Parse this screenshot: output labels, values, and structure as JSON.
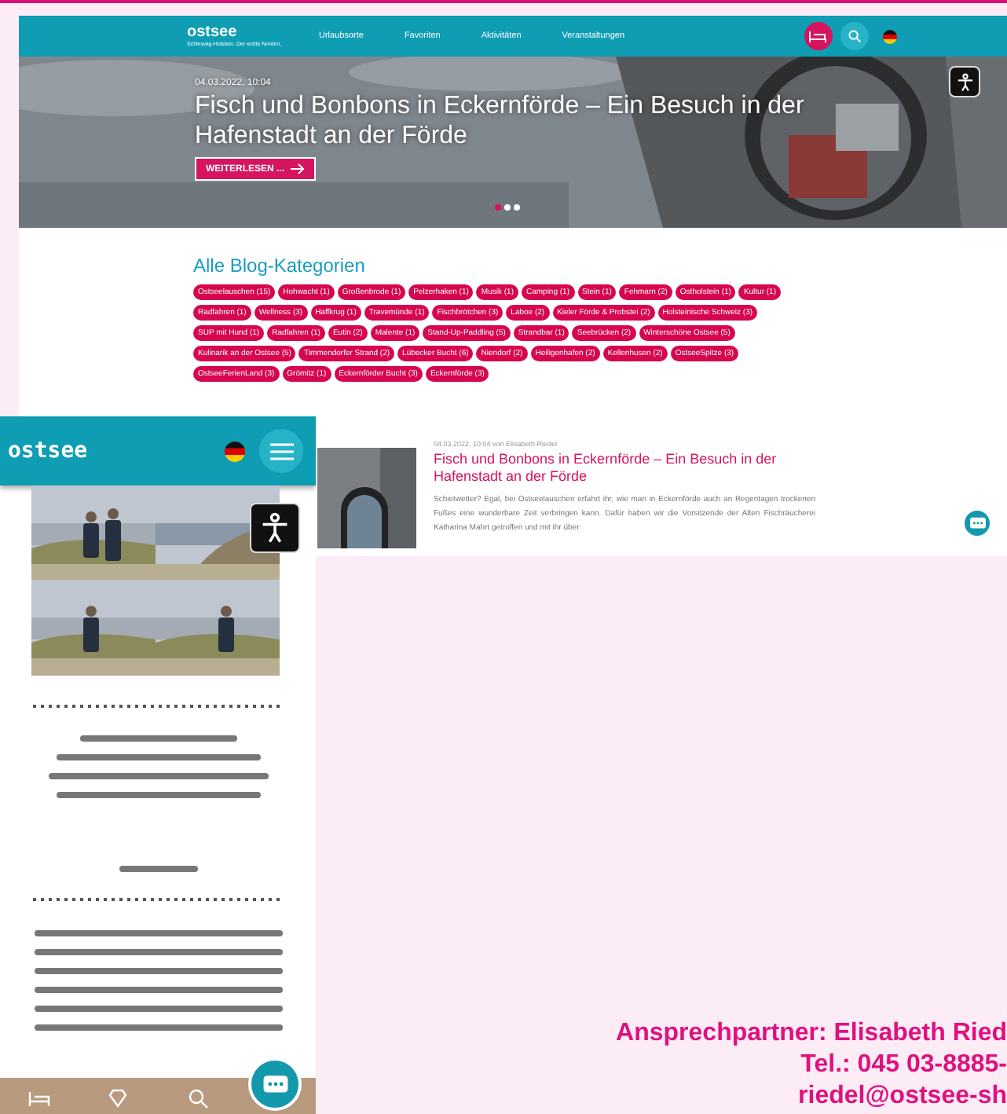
{
  "desktop": {
    "logo": {
      "name": "ostsee",
      "tagline": "Schleswig-Holstein. Der echte Norden."
    },
    "nav": [
      {
        "label": "Urlaubsorte"
      },
      {
        "label": "Favoriten"
      },
      {
        "label": "Aktivitäten"
      },
      {
        "label": "Veranstaltungen"
      }
    ],
    "hero": {
      "date": "04.03.2022, 10:04",
      "title": "Fisch und Bonbons in Eckernförde – Ein Besuch in der Hafenstadt an der Förde",
      "button": "WEITERLESEN ...",
      "slides": [
        {
          "selected": true
        },
        {
          "selected": false
        },
        {
          "selected": false
        }
      ]
    },
    "categories": {
      "title": "Alle Blog-Kategorien",
      "items": [
        "Ostseelauschen (15)",
        "Hohwacht (1)",
        "Großenbrode (1)",
        "Pelzerhaken (1)",
        "Musik (1)",
        "Camping (1)",
        "Stein (1)",
        "Fehmarn (2)",
        "Ostholstein (1)",
        "Kultur (1)",
        "Radfahren (1)",
        "Wellness (3)",
        "Haffkrug (1)",
        "Travemünde (1)",
        "Fischbrötchen (3)",
        "Laboe (2)",
        "Kieler Förde & Probstei (2)",
        "Holsteinische Schweiz (3)",
        "SUP mit Hund (1)",
        "Radfahren (1)",
        "Eutin (2)",
        "Malente (1)",
        "Stand-Up-Paddling (5)",
        "Strandbar (1)",
        "Seebrücken (2)",
        "Winterschöne Ostsee (5)",
        "Kulinarik an der Ostsee (5)",
        "Timmendorfer Strand (2)",
        "Lübecker Bucht (6)",
        "Niendorf (2)",
        "Heiligenhafen (2)",
        "Kellenhusen (2)",
        "OstseeSpitze (3)",
        "OstseeFerienLand (3)",
        "Grömitz (1)",
        "Eckernförder Bucht (3)",
        "Eckernförde (3)"
      ]
    },
    "post": {
      "meta": "04.03.2022, 10:04 von Elisabeth Riedel",
      "title": "Fisch und Bonbons in Eckernförde – Ein Besuch in der Hafenstadt an der Förde",
      "excerpt": "Schietwetter? Egal, bei Ostseelauschen erfahrt ihr, wie man in Eckernförde auch an Regentagen trockenen Fußes eine wunderbare Zeit verbringen kann. Dafür haben wir die Vorsitzende der Alten Fischräucherei Katharina Mahrt getroffen und mit ihr über"
    }
  },
  "mobile": {
    "logo": "ostsee"
  },
  "contact": [
    "Ansprechpartner: Elisabeth Ried",
    "Tel.: 045 03-8885-",
    "riedel@ostsee-sh"
  ]
}
